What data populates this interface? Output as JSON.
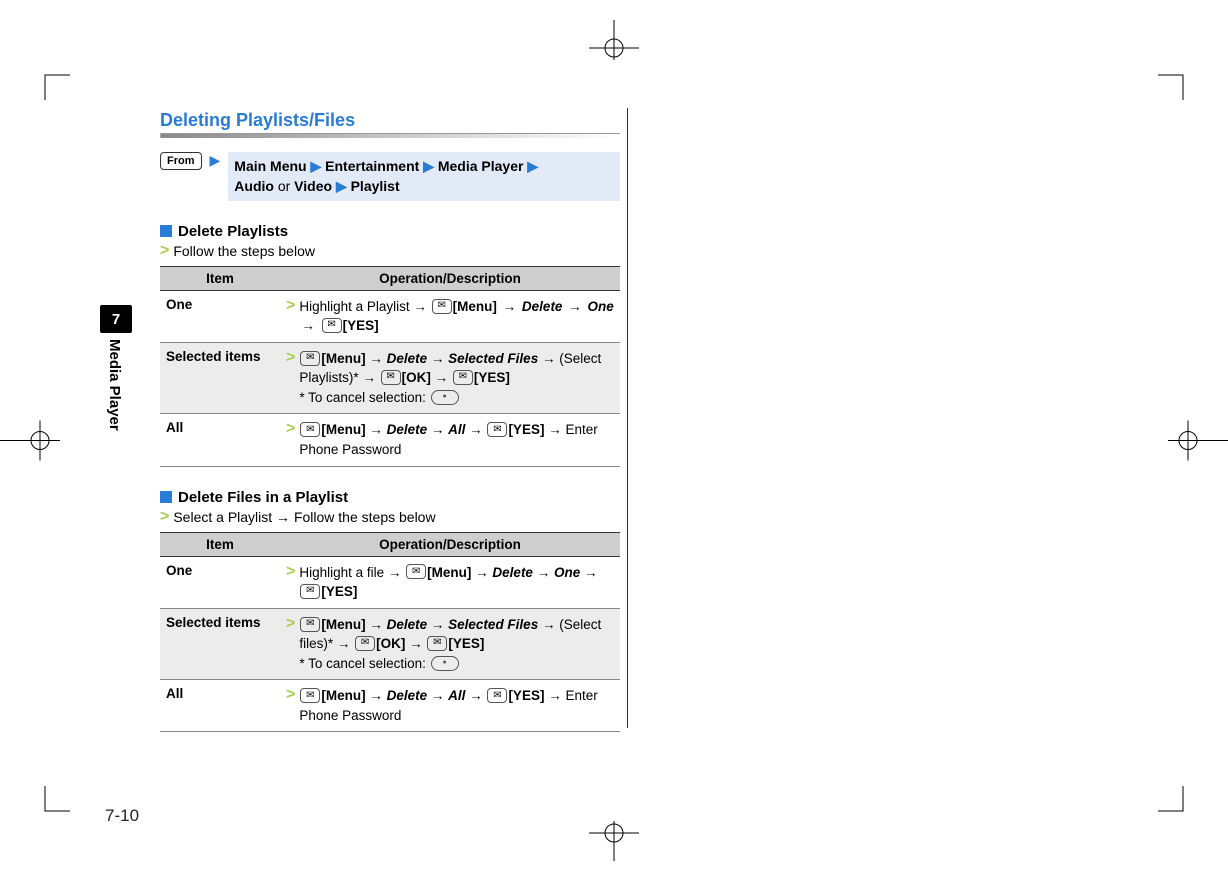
{
  "page_number": "7-10",
  "side_tab": {
    "chapter_number": "7",
    "chapter_label": "Media Player"
  },
  "section_title": "Deleting Playlists/Files",
  "from": {
    "badge": "From",
    "parts": [
      "Main Menu",
      "Entertainment",
      "Media Player"
    ],
    "line2_pre": "Audio ",
    "line2_or": "or",
    "line2_post": " Video",
    "line2_last": "Playlist"
  },
  "table_headers": {
    "col1": "Item",
    "col2": "Operation/Description"
  },
  "delete_playlists": {
    "heading": "Delete Playlists",
    "follow": "Follow the steps below",
    "rows": [
      {
        "item": "One",
        "pre": "Highlight a Playlist → ",
        "menu": "[Menu]",
        "t1": " → ",
        "dword1": "Delete",
        "t2": " → ",
        "dword2": "One",
        "t3": " → ",
        "yes": "[YES]"
      },
      {
        "item": "Selected items",
        "menu": "[Menu]",
        "t1": " → ",
        "dword1": "Delete",
        "t2": " → ",
        "dword2": "Selected Files",
        "t3": " → (Select Playlists)* → ",
        "ok": "[OK]",
        "t4": " → ",
        "yes": "[YES]",
        "note": "* To cancel selection: "
      },
      {
        "item": "All",
        "menu": "[Menu]",
        "t1": " → ",
        "dword1": "Delete",
        "t2": " → ",
        "dword2": "All",
        "t3": " → ",
        "yes": "[YES]",
        "post": " → Enter Phone Password"
      }
    ]
  },
  "delete_files": {
    "heading": "Delete Files in a Playlist",
    "follow": "Select a Playlist → Follow the steps below",
    "rows": [
      {
        "item": "One",
        "pre": "Highlight a file → ",
        "menu": "[Menu]",
        "t1": " → ",
        "dword1": "Delete",
        "t2": " → ",
        "dword2": "One",
        "t3": " → ",
        "yes": "[YES]"
      },
      {
        "item": "Selected items",
        "menu": "[Menu]",
        "t1": " → ",
        "dword1": "Delete",
        "t2": " → ",
        "dword2": "Selected Files",
        "t3": " → (Select files)* → ",
        "ok": "[OK]",
        "t4": " → ",
        "yes": "[YES]",
        "note": "* To cancel selection: "
      },
      {
        "item": "All",
        "menu": "[Menu]",
        "t1": " → ",
        "dword1": "Delete",
        "t2": " → ",
        "dword2": "All",
        "t3": " → ",
        "yes": "[YES]",
        "post": " → Enter Phone Password"
      }
    ]
  }
}
